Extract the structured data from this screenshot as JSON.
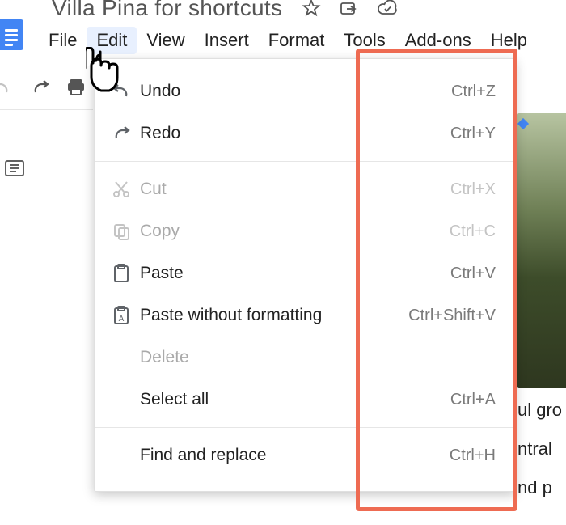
{
  "header": {
    "doc_title": "Villa Pina for shortcuts",
    "menus": [
      "File",
      "Edit",
      "View",
      "Insert",
      "Format",
      "Tools",
      "Add-ons",
      "Help"
    ],
    "active_menu_index": 1
  },
  "edit_menu": {
    "groups": [
      [
        {
          "icon": "undo-icon",
          "label": "Undo",
          "shortcut": "Ctrl+Z",
          "enabled": true
        },
        {
          "icon": "redo-icon",
          "label": "Redo",
          "shortcut": "Ctrl+Y",
          "enabled": true
        }
      ],
      [
        {
          "icon": "cut-icon",
          "label": "Cut",
          "shortcut": "Ctrl+X",
          "enabled": false
        },
        {
          "icon": "copy-icon",
          "label": "Copy",
          "shortcut": "Ctrl+C",
          "enabled": false
        },
        {
          "icon": "paste-icon",
          "label": "Paste",
          "shortcut": "Ctrl+V",
          "enabled": true
        },
        {
          "icon": "paste-plain-icon",
          "label": "Paste without formatting",
          "shortcut": "Ctrl+Shift+V",
          "enabled": true
        },
        {
          "icon": "",
          "label": "Delete",
          "shortcut": "",
          "enabled": false
        },
        {
          "icon": "",
          "label": "Select all",
          "shortcut": "Ctrl+A",
          "enabled": true
        }
      ],
      [
        {
          "icon": "",
          "label": "Find and replace",
          "shortcut": "Ctrl+H",
          "enabled": true
        }
      ]
    ]
  },
  "page_fragments": {
    "line1": "ul gro",
    "line2": "ntral",
    "line3": "nd p"
  }
}
